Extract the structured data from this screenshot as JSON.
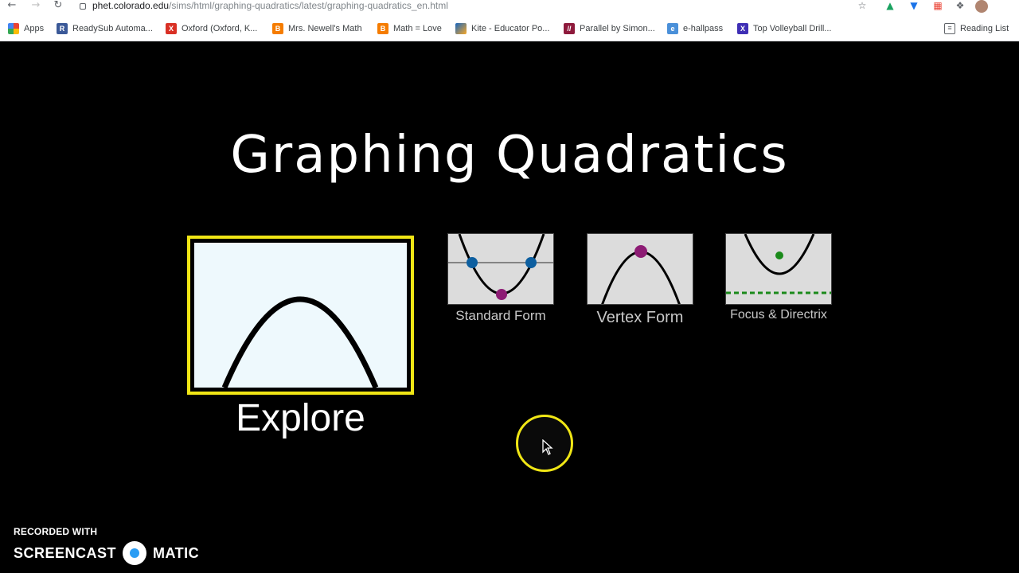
{
  "browser": {
    "url_host": "phet.colorado.edu",
    "url_path": "/sims/html/graphing-quadratics/latest/graphing-quadratics_en.html",
    "bookmarks": [
      {
        "label": "Apps",
        "icon": "apps-grid-icon",
        "color": "#ea4335"
      },
      {
        "label": "ReadySub Automa...",
        "icon": "readysub-icon",
        "color": "#3b5998"
      },
      {
        "label": "Oxford (Oxford, K...",
        "icon": "oxford-icon",
        "color": "#d93025"
      },
      {
        "label": "Mrs. Newell's Math",
        "icon": "blogger-icon",
        "color": "#f57c00"
      },
      {
        "label": "Math = Love",
        "icon": "blogger-icon",
        "color": "#f57c00"
      },
      {
        "label": "Kite - Educator Po...",
        "icon": "kite-icon",
        "color": "#6a1b9a"
      },
      {
        "label": "Parallel by Simon...",
        "icon": "parallel-icon",
        "color": "#8e1a3c"
      },
      {
        "label": "e-hallpass",
        "icon": "ehallpass-icon",
        "color": "#4a90d9"
      },
      {
        "label": "Top Volleyball Drill...",
        "icon": "x-icon",
        "color": "#3f2fb5"
      }
    ],
    "reading_list": "Reading List"
  },
  "sim": {
    "title": "Graphing Quadratics",
    "screens": [
      {
        "label": "Explore",
        "selected": true
      },
      {
        "label": "Standard Form",
        "selected": false
      },
      {
        "label": "Vertex Form",
        "selected": false
      },
      {
        "label": "Focus & Directrix",
        "selected": false
      }
    ]
  },
  "watermark": {
    "recorded_with": "RECORDED WITH",
    "brand_left": "SCREENCAST",
    "brand_right": "MATIC"
  },
  "colors": {
    "selection_border": "#f0e615",
    "thumb_bg": "#eef9fd",
    "small_thumb_bg": "#dcdcdc",
    "point_blue": "#0d5fa0",
    "point_magenta": "#8d1c74",
    "point_green": "#1a8a1a"
  }
}
